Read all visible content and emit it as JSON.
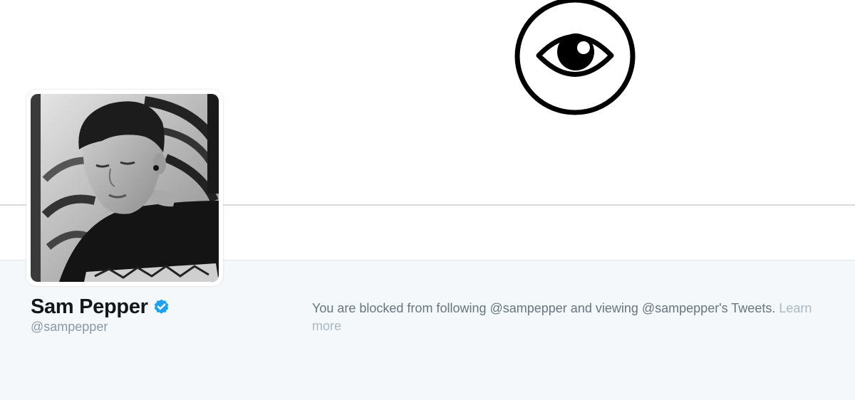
{
  "profile": {
    "name": "Sam Pepper",
    "screen_name": "@sampepper",
    "verified": true
  },
  "blocked_notice": {
    "message": "You are blocked from following @sampepper and viewing @sampepper's Tweets.",
    "learn_more": "Learn more"
  },
  "header": {
    "banner_icon": "eye-in-circle-icon"
  },
  "colors": {
    "verified_blue": "#1da1f2",
    "content_background": "#f5f8fa",
    "name_text": "#14171a",
    "muted_text": "#8899a6",
    "message_text": "#66757f",
    "link_muted": "#aab8c2"
  }
}
